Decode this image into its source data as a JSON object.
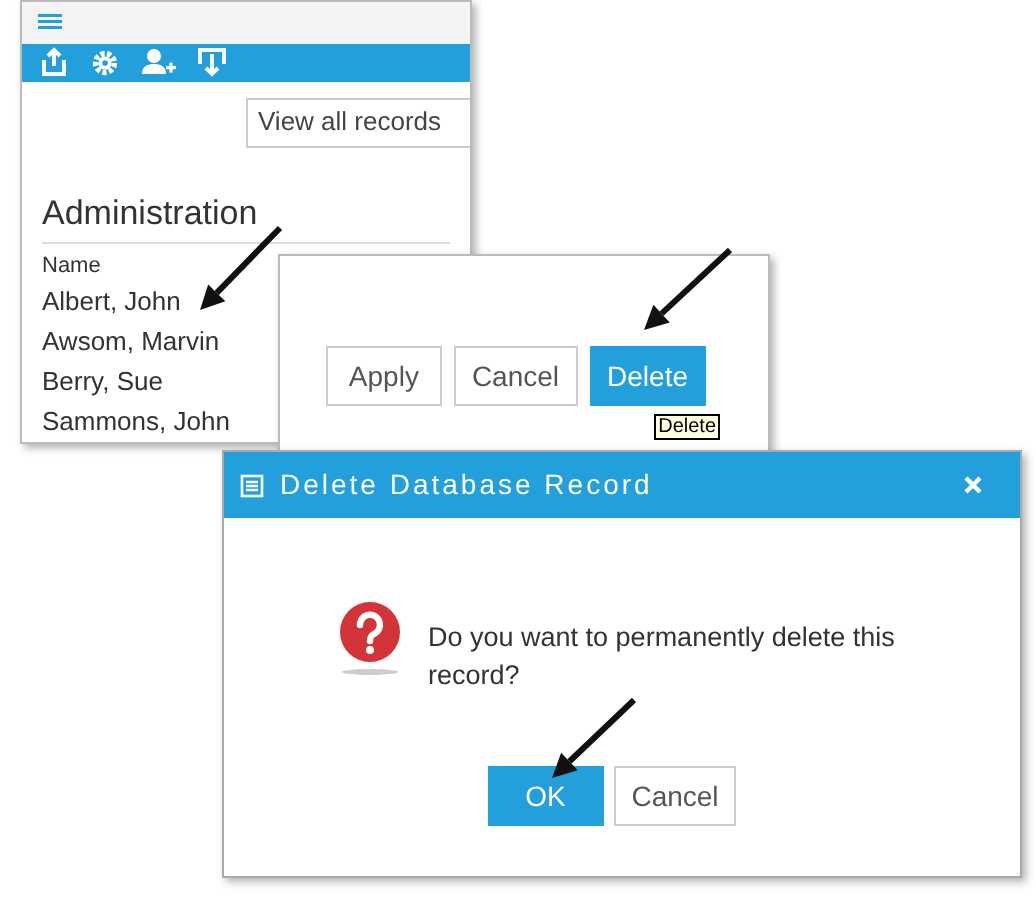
{
  "app_panel": {
    "view_select": {
      "value": "View all records"
    },
    "heading": "Administration",
    "column": "Name",
    "rows": [
      "Albert, John",
      "Awsom, Marvin",
      "Berry, Sue",
      "Sammons, John"
    ]
  },
  "edit_panel": {
    "buttons": [
      {
        "label": "Apply",
        "kind": "secondary"
      },
      {
        "label": "Cancel",
        "kind": "secondary"
      },
      {
        "label": "Delete",
        "kind": "primary"
      }
    ],
    "tooltip": "Delete"
  },
  "dialog": {
    "title": "Delete Database Record",
    "message": "Do you want to permanently delete this record?",
    "buttons": [
      {
        "label": "OK",
        "kind": "primary"
      },
      {
        "label": "Cancel",
        "kind": "secondary"
      }
    ]
  }
}
